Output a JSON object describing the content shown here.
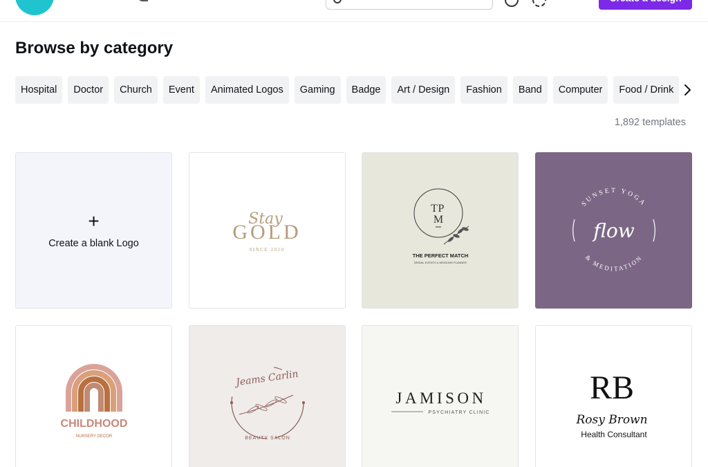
{
  "header": {
    "create_label": "Create a design"
  },
  "page": {
    "title": "Browse by category",
    "template_count": "1,892 templates"
  },
  "categories": [
    "Hospital",
    "Doctor",
    "Church",
    "Event",
    "Animated Logos",
    "Gaming",
    "Badge",
    "Art / Design",
    "Fashion",
    "Band",
    "Computer",
    "Food / Drink"
  ],
  "blank_card": {
    "plus": "+",
    "label": "Create a blank Logo"
  },
  "templates": [
    {
      "script": "Stay",
      "main": "GOLD",
      "sub": "SINCE 2020"
    },
    {
      "monogram_top": "T",
      "monogram_p": "P",
      "monogram_m": "M",
      "main": "THE PERFECT MATCH",
      "sub": "BRIDAL EVENTS & WEDDING PLANNER"
    },
    {
      "arc_top": "SUNSET YOGA",
      "script": "flow",
      "arc_bottom": "& MEDITATION"
    },
    {
      "main": "CHILDHOOD",
      "sub": "NURSERY DECOR"
    },
    {
      "script": "Jeams Carlin",
      "sub": "BEAUTY SALON"
    },
    {
      "main": "JAMISON",
      "sub": "PSYCHIATRY CLINIC"
    },
    {
      "monogram": "RB",
      "script": "Rosy Brown",
      "sub": "Health Consultant"
    }
  ],
  "colors": {
    "accent": "#7d2ae8",
    "brand": "#1fc4cf",
    "chip_bg": "#f1f2f4",
    "yoga_bg": "#7b6785"
  }
}
